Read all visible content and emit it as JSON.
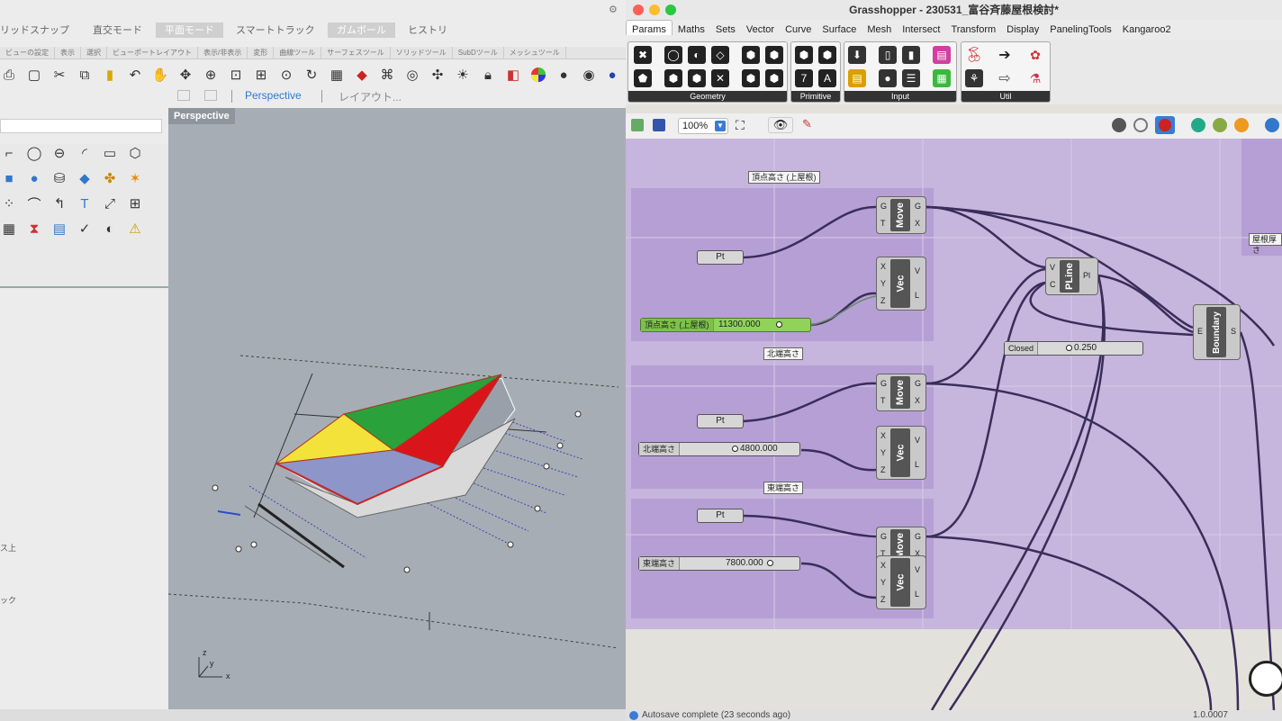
{
  "rhino": {
    "top_modes": [
      "リッドスナップ",
      "直交モード",
      "平面モード",
      "スマートトラック",
      "ガムボール",
      "ヒストリ"
    ],
    "tab_row": [
      "ビューの設定",
      "表示",
      "選択",
      "ビューポートレイアウト",
      "表示/非表示",
      "変形",
      "曲線ツール",
      "サーフェスツール",
      "ソリッドツール",
      "SubDツール",
      "メッシュツール"
    ],
    "viewport_tabs": [
      "Perspective",
      "レイアウト..."
    ],
    "viewport_label": "Perspective",
    "side_labels": [
      "ス上",
      "ック"
    ],
    "axis": {
      "z": "z",
      "y": "y",
      "x": "x"
    }
  },
  "gh": {
    "title": "Grasshopper - 230531_富谷斉藤屋根検討*",
    "tabs": [
      "Params",
      "Maths",
      "Sets",
      "Vector",
      "Curve",
      "Surface",
      "Mesh",
      "Intersect",
      "Transform",
      "Display",
      "PanelingTools",
      "Kangaroo2"
    ],
    "ribbon_groups": [
      "Geometry",
      "Primitive",
      "Input",
      "Util"
    ],
    "zoom": "100%",
    "status": "Autosave complete (23 seconds ago)",
    "version": "1.0.0007",
    "groups": [
      {
        "title": "頂点高さ (上屋根)",
        "slider_label": "頂点高さ (上屋根)",
        "slider_value": "11300.000"
      },
      {
        "title": "北端高さ",
        "slider_label": "北端高さ",
        "slider_value": "4800.000"
      },
      {
        "title": "東端高さ",
        "slider_label": "東端高さ",
        "slider_value": "7800.000"
      }
    ],
    "components": {
      "move": "Move",
      "vec": "Vec",
      "pline": "PLine",
      "boundary": "Boundary",
      "pt": "Pt",
      "closed_label": "Closed",
      "closed_value": "0.250",
      "edge_panel": "屋根厚さ"
    },
    "pins": {
      "g": "G",
      "t": "T",
      "x": "X",
      "y": "Y",
      "z": "Z",
      "v": "V",
      "l": "L",
      "c": "C",
      "pl": "Pl",
      "e": "E",
      "s": "S"
    }
  },
  "colors": {
    "group": "#b9a5d6",
    "slider_green": "#8fd35a",
    "roof_yellow": "#f2e23a",
    "roof_green": "#2aa13a",
    "roof_red": "#d9151b",
    "roof_blue": "#8e95c9"
  }
}
